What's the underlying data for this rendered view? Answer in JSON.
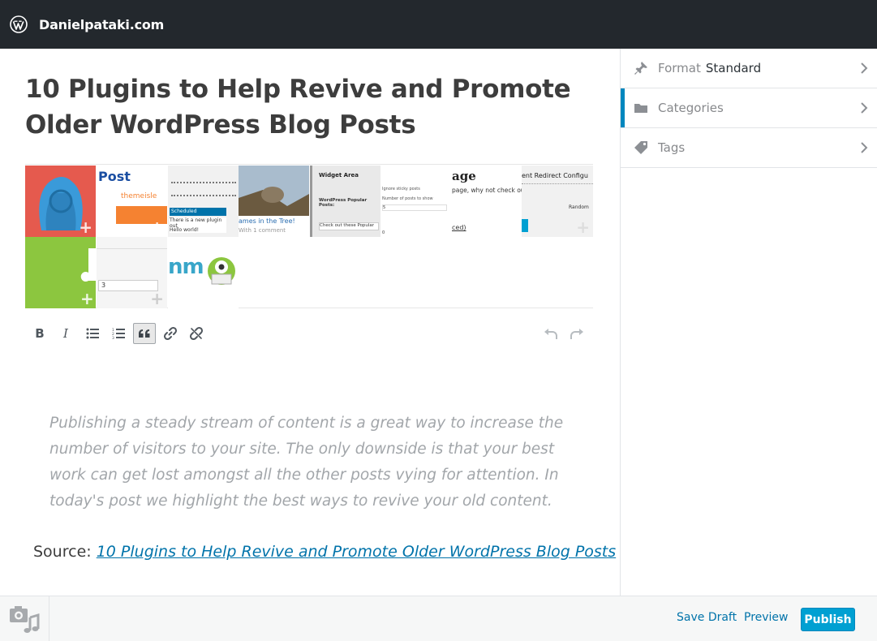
{
  "topbar": {
    "site_name": "Danielpataki.com"
  },
  "post": {
    "title": "10 Plugins to Help Revive and Promote Older WordPress Blog Posts",
    "quote": "Publishing a steady stream of content is a great way to increase the number of visitors to your site. The only downside is that your best work can get lost amongst all the other posts vying for attention. In today's post we highlight the best ways to revive your old content.",
    "source_label": "Source: ",
    "source_link": "10 Plugins to Help Revive and Promote Older WordPress Blog Posts"
  },
  "gallery": {
    "thumbs": [
      {
        "name": "gallery-thumb-wp-hoodie",
        "colors": [
          "#e55a4e",
          "#3a9ad9"
        ]
      },
      {
        "name": "gallery-thumb-post-themeisle",
        "text": "Post",
        "sub": "themeisle",
        "colors": [
          "#ffffff",
          "#f58231"
        ]
      },
      {
        "name": "gallery-thumb-editor-toolbar",
        "text": "Scheduled",
        "sub": "There is a new plugin out",
        "sub2": "Hello world!",
        "colors": [
          "#f1f1f1",
          "#0073aa"
        ]
      },
      {
        "name": "gallery-thumb-cat-tree",
        "text": "ames in the Tree!",
        "sub": "With 1 comment",
        "colors": [
          "#a6b8c8",
          "#6b5a40"
        ]
      },
      {
        "name": "gallery-thumb-widget-area",
        "text": "Widget Area",
        "sub": "WordPress Popular Posts:",
        "sub2": "Check out these Popular",
        "colors": [
          "#f1f1f1",
          "#999999"
        ]
      },
      {
        "name": "gallery-thumb-page",
        "text": "age",
        "sub": "page, why not check out t",
        "colors": [
          "#ffffff",
          "#222222"
        ]
      },
      {
        "name": "gallery-thumb-redirect",
        "text": "ent Redirect Configu",
        "sub": "Random",
        "colors": [
          "#f1f1f1",
          "#0073aa"
        ]
      },
      {
        "name": "gallery-thumb-green-puzzle",
        "colors": [
          "#8cc63f",
          "#ffffff"
        ]
      },
      {
        "name": "gallery-thumb-number-select",
        "text": "3",
        "colors": [
          "#f5f5f5",
          "#333333"
        ]
      },
      {
        "name": "gallery-thumb-optinmonster",
        "text": "nm",
        "colors": [
          "#ffffff",
          "#39a6c9"
        ]
      }
    ],
    "extra_labels": {
      "ignore": "Ignore sticky posts",
      "number": "Number of posts to show",
      "five": "5",
      "zero": "0"
    }
  },
  "toolbar": {
    "buttons": [
      {
        "name": "bold-button",
        "label": "B"
      },
      {
        "name": "italic-button",
        "label": "I"
      },
      {
        "name": "bulleted-list-button",
        "label": ""
      },
      {
        "name": "numbered-list-button",
        "label": ""
      },
      {
        "name": "blockquote-button",
        "label": ""
      },
      {
        "name": "insert-link-button",
        "label": ""
      },
      {
        "name": "remove-link-button",
        "label": ""
      }
    ]
  },
  "sidebar": {
    "format_label": "Format",
    "format_value": "Standard",
    "categories_label": "Categories",
    "tags_label": "Tags"
  },
  "bottombar": {
    "save_draft": "Save Draft",
    "preview": "Preview",
    "publish": "Publish"
  },
  "colors": {
    "accent": "#0087be",
    "publish": "#00a0d2",
    "topbar": "#23282d",
    "link": "#0073aa"
  }
}
